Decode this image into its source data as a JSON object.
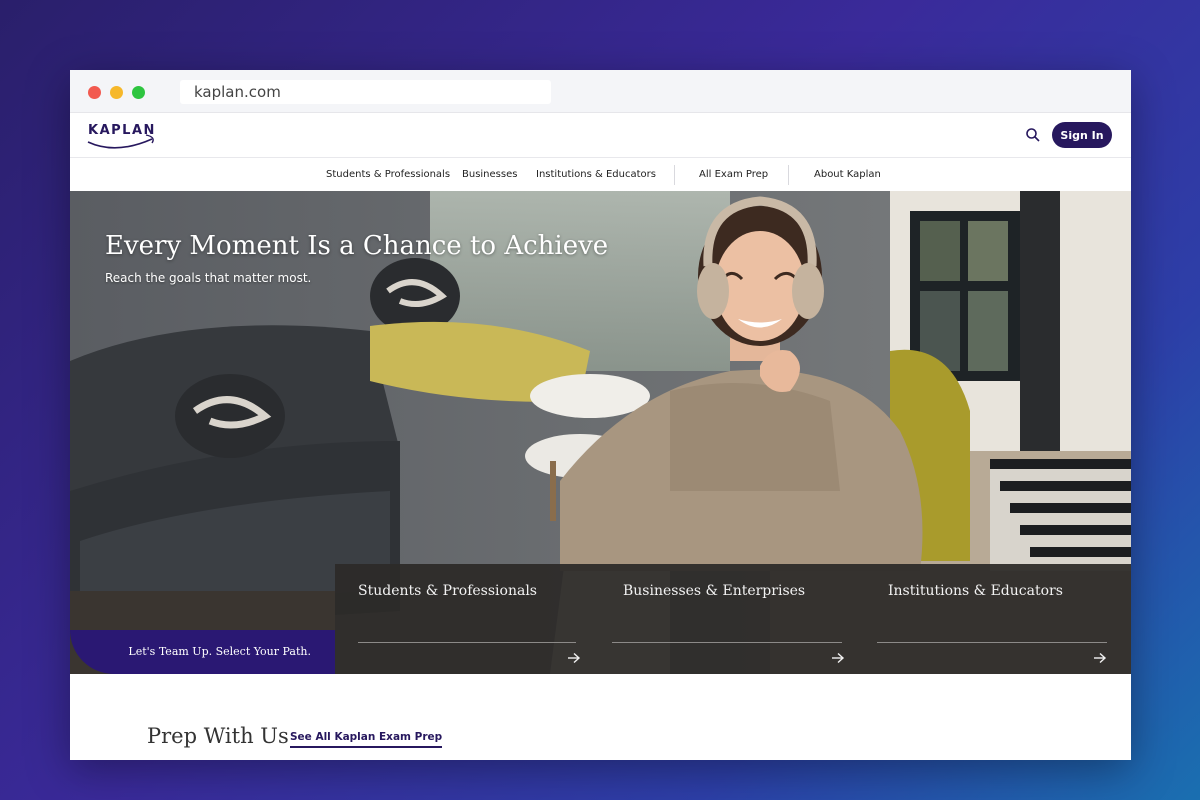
{
  "browser": {
    "url": "kaplan.com"
  },
  "header": {
    "logo_text": "KAPLAN",
    "sign_in_label": "Sign In",
    "search_icon": "search-icon"
  },
  "nav": {
    "items": [
      {
        "label": "Students & Professionals"
      },
      {
        "label": "Businesses"
      },
      {
        "label": "Institutions & Educators"
      },
      {
        "label": "All Exam Prep"
      },
      {
        "label": "About Kaplan"
      }
    ]
  },
  "hero": {
    "title": "Every Moment Is a Chance to Achieve",
    "subtitle": "Reach the goals that matter most.",
    "team_up_label": "Let's Team Up. Select Your Path.",
    "paths": [
      {
        "label": "Students & Professionals",
        "icon": "arrow-right-icon"
      },
      {
        "label": "Businesses & Enterprises",
        "icon": "arrow-right-icon"
      },
      {
        "label": "Institutions & Educators",
        "icon": "arrow-right-icon"
      }
    ]
  },
  "prep": {
    "title": "Prep With Us",
    "link_label": "See All Kaplan Exam Prep"
  },
  "colors": {
    "brand": "#27185e",
    "team_up_bg": "#2a1873",
    "path_panel_bg": "#2d2a28",
    "background_gradient_start": "#2a1f6b",
    "background_gradient_end": "#1a6fb0"
  }
}
